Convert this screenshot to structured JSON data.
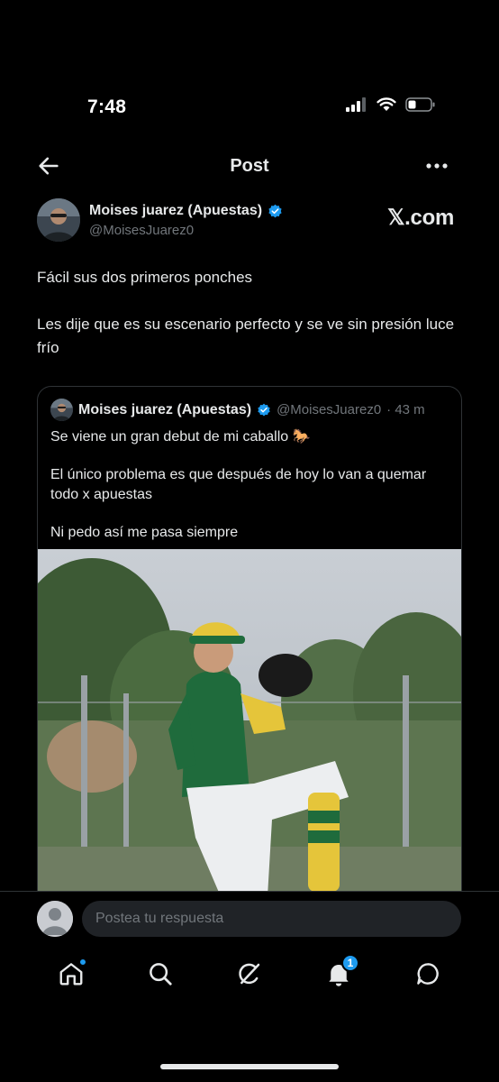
{
  "status_bar": {
    "time": "7:48"
  },
  "header": {
    "title": "Post"
  },
  "author": {
    "name": "Moises juarez (Apuestas)",
    "handle": "@MoisesJuarez0",
    "verified": true
  },
  "source_label": "𝕏.com",
  "post": {
    "paragraphs": [
      "Fácil sus dos primeros ponches",
      "Les dije que es su escenario perfecto y se ve sin presión luce frío"
    ]
  },
  "quoted_post": {
    "name": "Moises juarez (Apuestas)",
    "handle": "@MoisesJuarez0",
    "time": "· 43 m",
    "paragraphs": [
      "Se viene un gran debut de mi caballo 🐎",
      "El único problema es que después de hoy lo van a quemar todo x apuestas",
      "Ni pedo así me pasa siempre"
    ],
    "image_icon": "baseball-pitcher-photo"
  },
  "reply": {
    "placeholder": "Postea tu respuesta"
  },
  "bottom_nav": {
    "items": [
      "home-icon",
      "search-icon",
      "grok-icon",
      "bell-icon",
      "messages-icon"
    ],
    "notification_count": "1"
  },
  "colors": {
    "background": "#000000",
    "text": "#e7e9ea",
    "secondary": "#71767b",
    "accent": "#1d9bf0",
    "border": "#2f3336"
  }
}
